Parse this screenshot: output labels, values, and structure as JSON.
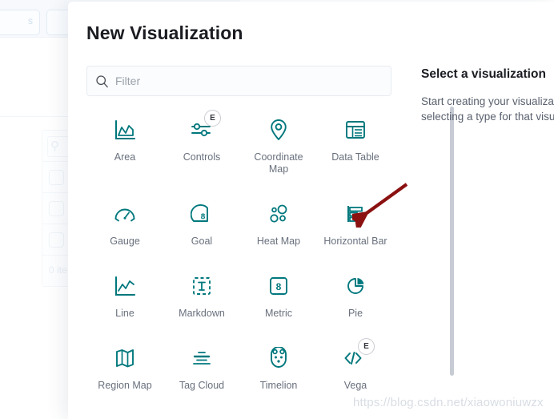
{
  "background": {
    "tab_label": "s",
    "search_icon": "search-icon",
    "item_count_text": "0 ite"
  },
  "modal": {
    "title": "New Visualization",
    "filter": {
      "icon": "search-icon",
      "value": "",
      "placeholder": "Filter"
    },
    "viz_types": [
      {
        "label": "Area",
        "icon": "area-chart-icon",
        "experimental": false,
        "badge": ""
      },
      {
        "label": "Controls",
        "icon": "controls-sliders-icon",
        "experimental": true,
        "badge": "E"
      },
      {
        "label": "Coordinate Map",
        "icon": "map-pin-icon",
        "experimental": false,
        "badge": ""
      },
      {
        "label": "Data Table",
        "icon": "data-table-icon",
        "experimental": false,
        "badge": ""
      },
      {
        "label": "Gauge",
        "icon": "gauge-icon",
        "experimental": false,
        "badge": ""
      },
      {
        "label": "Goal",
        "icon": "goal-icon",
        "experimental": false,
        "badge": ""
      },
      {
        "label": "Heat Map",
        "icon": "heat-map-icon",
        "experimental": false,
        "badge": ""
      },
      {
        "label": "Horizontal Bar",
        "icon": "horizontal-bar-icon",
        "experimental": false,
        "badge": ""
      },
      {
        "label": "Line",
        "icon": "line-chart-icon",
        "experimental": false,
        "badge": ""
      },
      {
        "label": "Markdown",
        "icon": "markdown-text-icon",
        "experimental": false,
        "badge": ""
      },
      {
        "label": "Metric",
        "icon": "metric-number-icon",
        "experimental": false,
        "badge": ""
      },
      {
        "label": "Pie",
        "icon": "pie-chart-icon",
        "experimental": false,
        "badge": ""
      },
      {
        "label": "Region Map",
        "icon": "region-map-icon",
        "experimental": false,
        "badge": ""
      },
      {
        "label": "Tag Cloud",
        "icon": "tag-cloud-icon",
        "experimental": false,
        "badge": ""
      },
      {
        "label": "Timelion",
        "icon": "timelion-bear-icon",
        "experimental": false,
        "badge": ""
      },
      {
        "label": "Vega",
        "icon": "vega-code-icon",
        "experimental": true,
        "badge": "E"
      }
    ],
    "detail": {
      "title": "Select a visualization",
      "body": "Start creating your visualization by selecting a type for that visualization."
    }
  },
  "annotation": {
    "arrow": "red-arrow-pointing-to-horizontal-bar",
    "watermark": "https://blog.csdn.net/xiaowoniuwzx"
  },
  "colors": {
    "icon_teal": "#00787d",
    "label_gray": "#69707d",
    "title_dark": "#1a1c21",
    "arrow_red": "#8b1111",
    "scrollbar": "#c6cbd4",
    "deco_mint": "#d7e9e6",
    "deco_purple": "#bdb6c9"
  }
}
